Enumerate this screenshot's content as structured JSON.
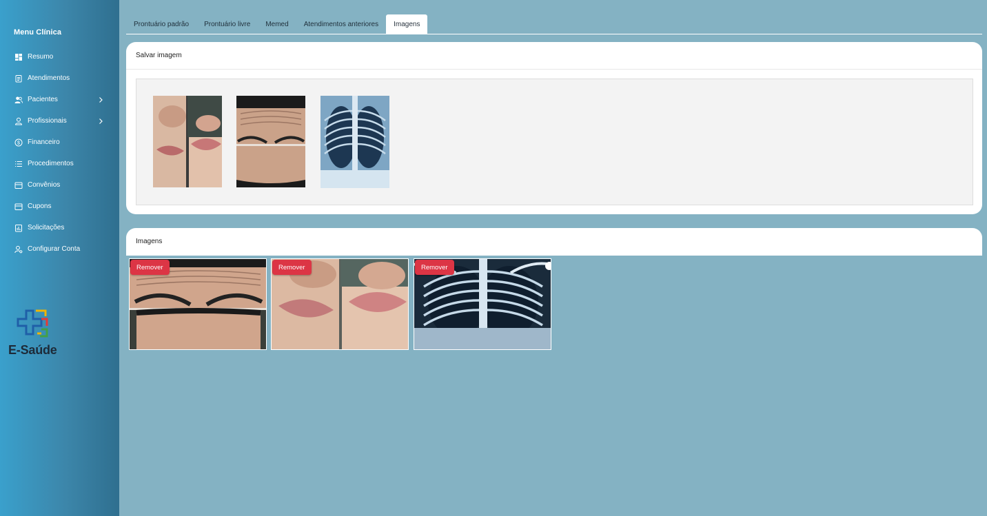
{
  "sidebar": {
    "title": "Menu Clínica",
    "items": [
      {
        "label": "Resumo",
        "icon": "dashboard-icon",
        "has_submenu": false
      },
      {
        "label": "Atendimentos",
        "icon": "clipboard-icon",
        "has_submenu": false
      },
      {
        "label": "Pacientes",
        "icon": "users-icon",
        "has_submenu": true
      },
      {
        "label": "Profissionais",
        "icon": "user-icon",
        "has_submenu": true
      },
      {
        "label": "Financeiro",
        "icon": "dollar-circle-icon",
        "has_submenu": false
      },
      {
        "label": "Procedimentos",
        "icon": "list-icon",
        "has_submenu": false
      },
      {
        "label": "Convênios",
        "icon": "card-icon",
        "has_submenu": false
      },
      {
        "label": "Cupons",
        "icon": "card-icon",
        "has_submenu": false
      },
      {
        "label": "Solicitações",
        "icon": "chart-file-icon",
        "has_submenu": false
      },
      {
        "label": "Configurar Conta",
        "icon": "user-settings-icon",
        "has_submenu": false
      }
    ],
    "logo_text": "E-Saúde"
  },
  "tabs": [
    {
      "label": "Prontuário padrão",
      "active": false
    },
    {
      "label": "Prontuário livre",
      "active": false
    },
    {
      "label": "Memed",
      "active": false
    },
    {
      "label": "Atendimentos anteriores",
      "active": false
    },
    {
      "label": "Imagens",
      "active": true
    }
  ],
  "upload_card": {
    "title": "Salvar imagem",
    "previews": [
      "lips-before-after",
      "forehead-wrinkles",
      "chest-xray"
    ]
  },
  "gallery": {
    "title": "Imagens",
    "remove_label": "Remover",
    "images": [
      "forehead-wrinkles",
      "lips-before-after",
      "chest-xray"
    ]
  },
  "colors": {
    "background": "#84b2c3",
    "sidebar_start": "#3aa0cc",
    "sidebar_end": "#2f6f8f",
    "remove_button": "#dc3545"
  }
}
